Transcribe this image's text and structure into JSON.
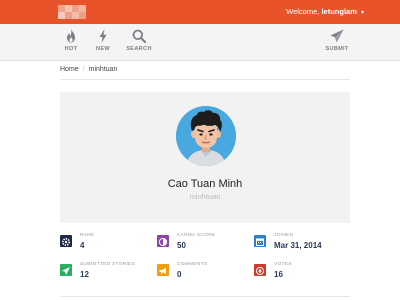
{
  "header": {
    "welcome_prefix": "Welcome,",
    "username": "letunglam",
    "caret": "▾",
    "bar_color": "#e8532a"
  },
  "nav": {
    "items": [
      {
        "label": "HOT",
        "icon": "flame-icon"
      },
      {
        "label": "NEW",
        "icon": "lightning-icon"
      },
      {
        "label": "SEARCH",
        "icon": "search-icon"
      },
      {
        "label": "SUBMIT",
        "icon": "paper-plane-icon"
      }
    ]
  },
  "breadcrumb": {
    "home": "Home",
    "separator": "/",
    "current": "minhtuan"
  },
  "profile": {
    "name": "Cao Tuan Minh",
    "username": "minhtuan",
    "avatar_bg": "#4aa8e0"
  },
  "stats": [
    {
      "label": "RANK",
      "value": "4",
      "color": "#1e2a47",
      "icon": "gear-icon"
    },
    {
      "label": "KARMA SCORE",
      "value": "50",
      "color": "#8e44ad",
      "icon": "contrast-icon"
    },
    {
      "label": "JOINED",
      "value": "Mar 31, 2014",
      "color": "#2f80c8",
      "icon": "calendar-icon"
    },
    {
      "label": "SUBMITTED STORIES",
      "value": "12",
      "color": "#27ae60",
      "icon": "send-icon"
    },
    {
      "label": "COMMENTS",
      "value": "0",
      "color": "#f39c12",
      "icon": "megaphone-icon"
    },
    {
      "label": "VOTES",
      "value": "16",
      "color": "#d0392b",
      "icon": "vote-icon"
    }
  ]
}
